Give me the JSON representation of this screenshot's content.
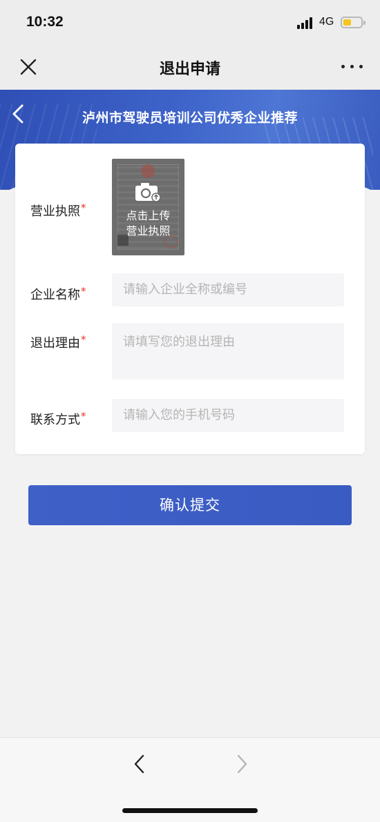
{
  "status_bar": {
    "time": "10:32",
    "network": "4G",
    "battery_percent": 45
  },
  "nav": {
    "title": "退出申请",
    "close_icon": "close-icon",
    "more_icon": "more-dots-icon"
  },
  "banner": {
    "title": "泸州市驾驶员培训公司优秀企业推荐",
    "back_icon": "chevron-left-icon"
  },
  "form": {
    "license": {
      "label": "营业执照",
      "required_mark": "*",
      "upload_line1": "点击上传",
      "upload_line2": "营业执照"
    },
    "company": {
      "label": "企业名称",
      "required_mark": "*",
      "placeholder": "请输入企业全称或编号"
    },
    "reason": {
      "label": "退出理由",
      "required_mark": "*",
      "placeholder": "请填写您的退出理由"
    },
    "contact": {
      "label": "联系方式",
      "required_mark": "*",
      "placeholder": "请输入您的手机号码"
    }
  },
  "submit": {
    "label": "确认提交"
  },
  "colors": {
    "primary": "#3a5bc2",
    "required": "#e0352b",
    "placeholder": "#b5b5b5"
  }
}
